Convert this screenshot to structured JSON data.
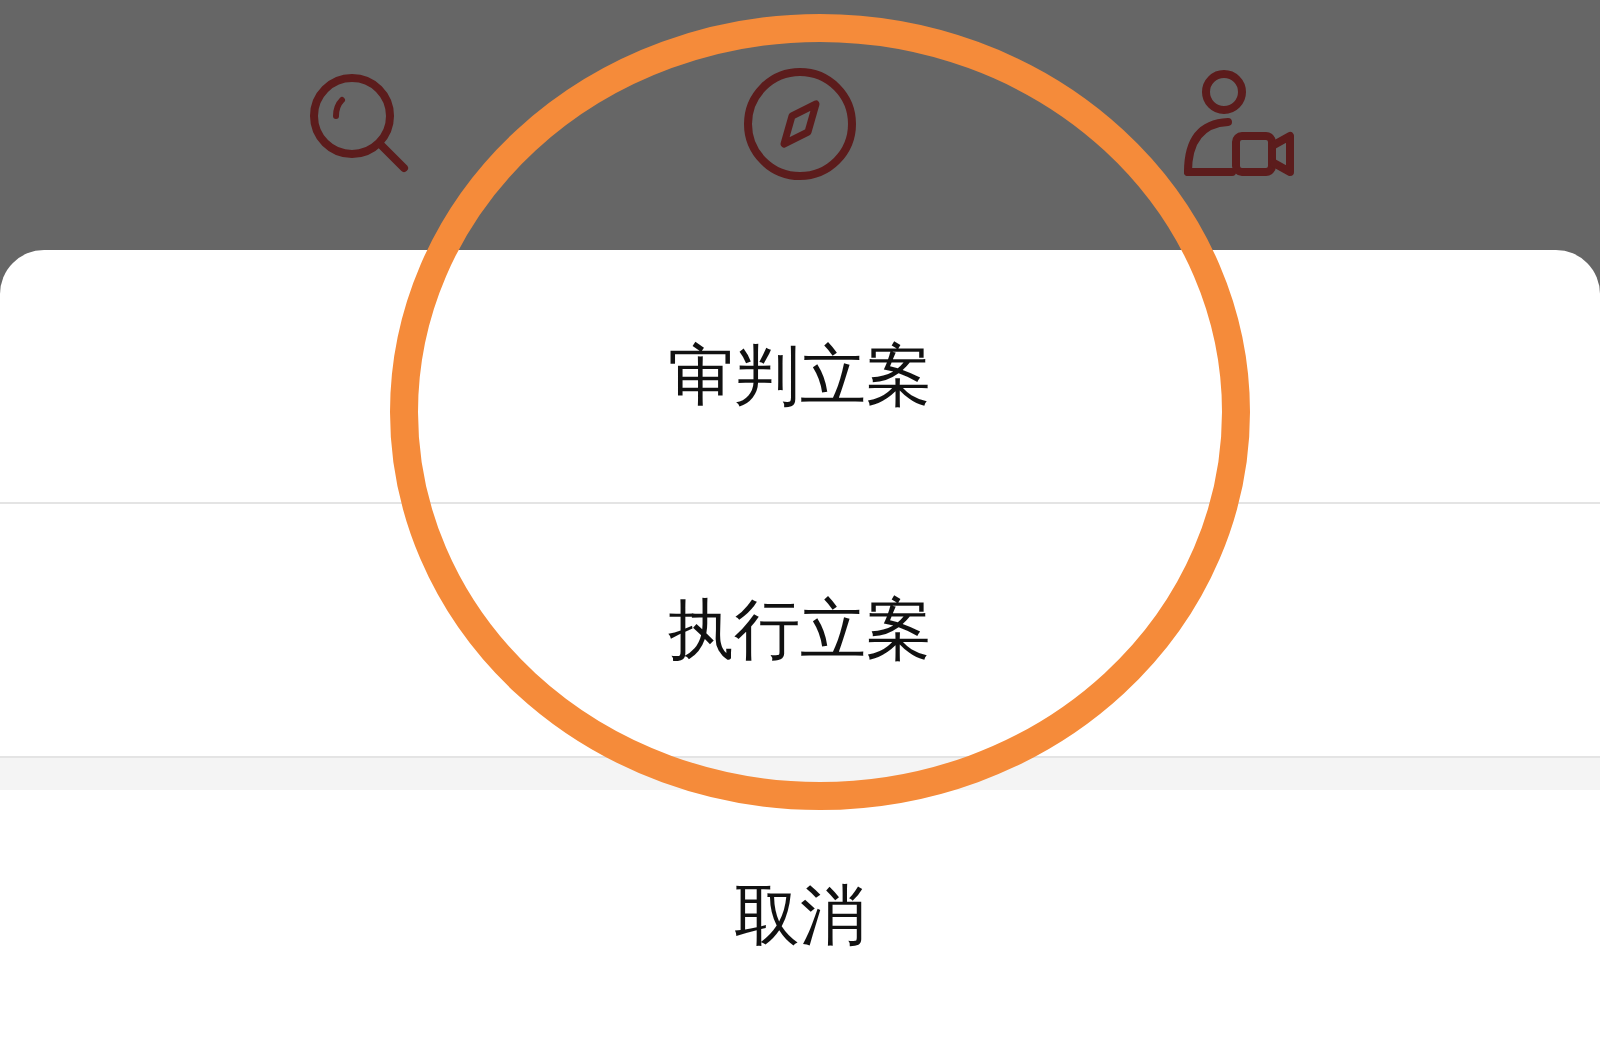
{
  "action_sheet": {
    "options": [
      "审判立案",
      "执行立案"
    ],
    "cancel": "取消"
  }
}
